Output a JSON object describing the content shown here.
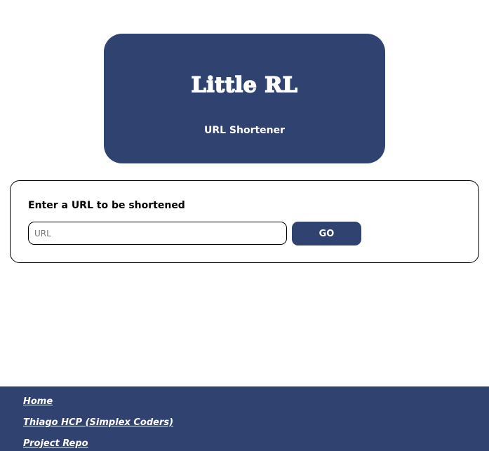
{
  "header": {
    "title": "Little RL",
    "subtitle": "URL Shortener"
  },
  "form": {
    "label": "Enter a URL to be shortened",
    "input_placeholder": "URL",
    "input_value": "",
    "submit_label": "GO"
  },
  "footer": {
    "links": [
      {
        "label": "Home"
      },
      {
        "label": "Thiago HCP (Simplex Coders)"
      },
      {
        "label": "Project Repo"
      }
    ]
  },
  "colors": {
    "brand": "#2f4270",
    "background": "#ffffff",
    "text_on_brand": "#ffffff",
    "border": "#000000"
  }
}
